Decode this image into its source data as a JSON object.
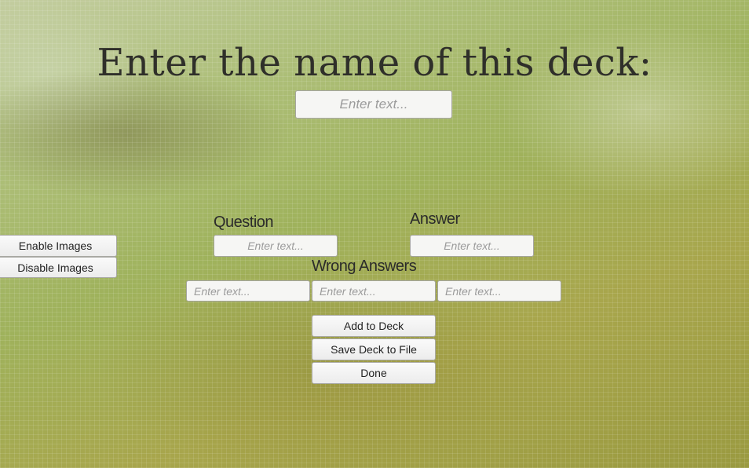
{
  "deck_name": {
    "title": "Enter the name of this deck:",
    "placeholder": "Enter text..."
  },
  "image_controls": {
    "enable_label": "Enable Images",
    "disable_label": "Disable Images"
  },
  "question": {
    "label": "Question",
    "placeholder": "Enter text..."
  },
  "answer": {
    "label": "Answer",
    "placeholder": "Enter text..."
  },
  "wrong_answers": {
    "label": "Wrong Answers",
    "placeholders": [
      "Enter text...",
      "Enter text...",
      "Enter text..."
    ]
  },
  "actions": {
    "add_label": "Add to Deck",
    "save_label": "Save Deck to File",
    "done_label": "Done"
  }
}
